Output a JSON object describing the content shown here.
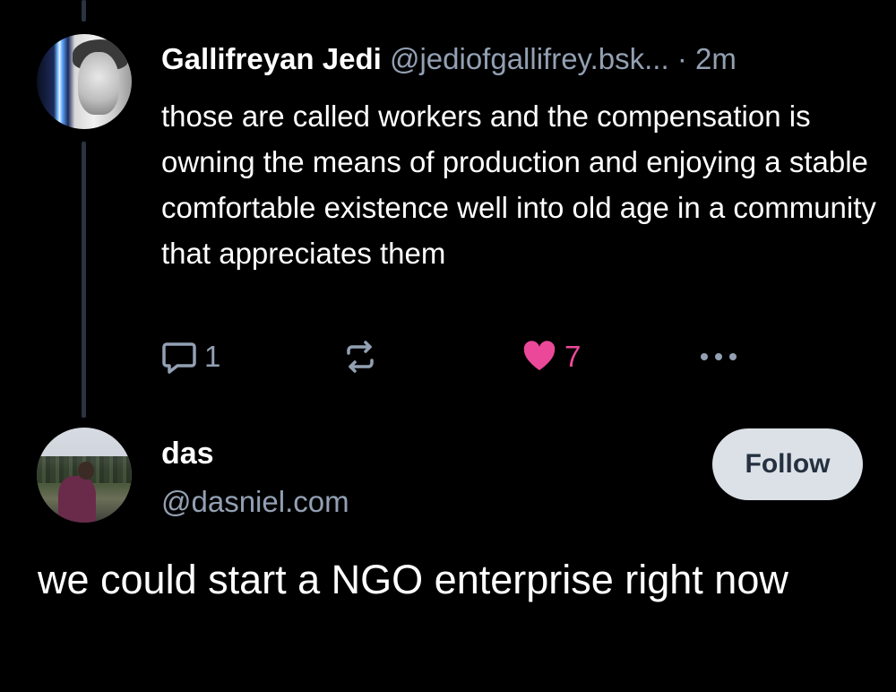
{
  "parent_post": {
    "display_name": "Gallifreyan Jedi",
    "handle": "@jediofgallifrey.bsk...",
    "separator": "·",
    "time": "2m",
    "text": "those are called workers and the compensation is owning the means of production and enjoying a stable comfortable existence well into old age in a community that appreciates them",
    "reply_count": "1",
    "like_count": "7"
  },
  "main_post": {
    "author": {
      "display_name": "das",
      "handle": "@dasniel.com"
    },
    "follow_label": "Follow",
    "text": "we could start a NGO enterprise right now"
  },
  "icons": {
    "reply": "speech-bubble-icon",
    "repost": "repost-arrows-icon",
    "like": "heart-icon",
    "more": "ellipsis-icon"
  },
  "colors": {
    "background": "#000000",
    "text_primary": "#ffffff",
    "text_secondary": "#93a0b3",
    "like_accent": "#ec4899",
    "follow_button_bg": "#dce1e8",
    "follow_button_text": "#25313f",
    "thread_line": "#2a3440"
  }
}
